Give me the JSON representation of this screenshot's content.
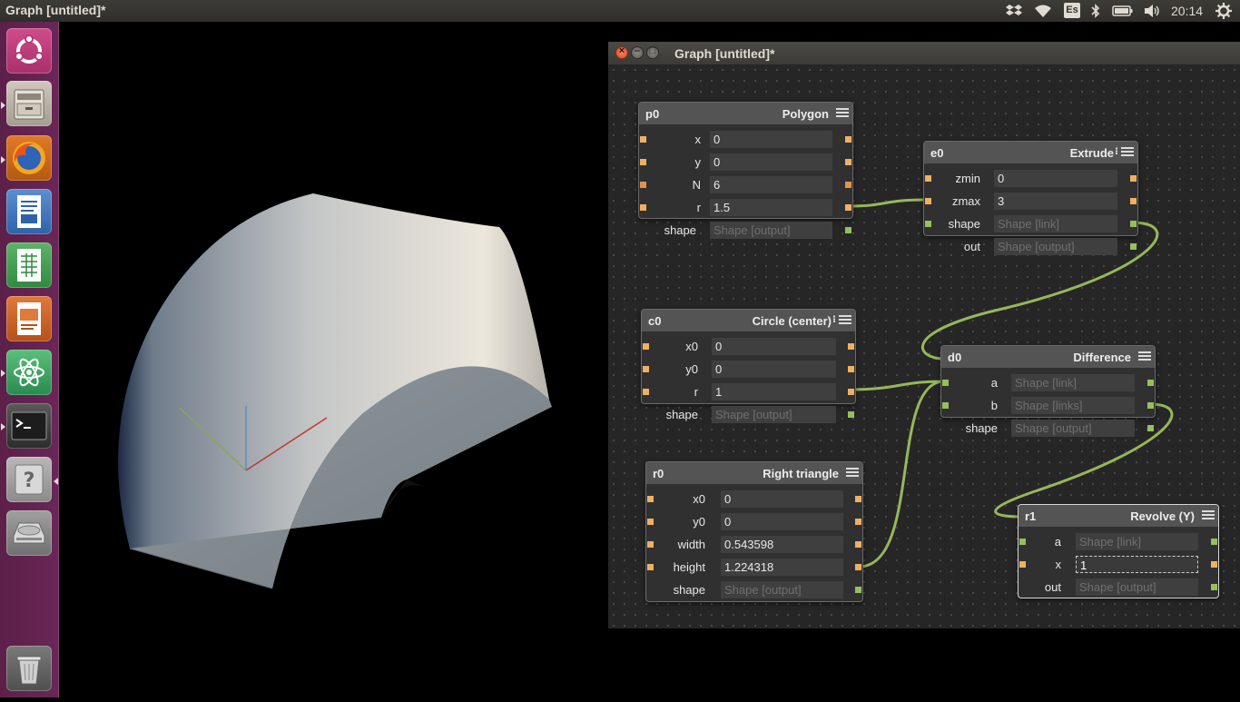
{
  "topbar": {
    "title": "Graph [untitled]*",
    "keyboard_layout": "Es",
    "clock": "20:14"
  },
  "launcher": {
    "items": [
      {
        "name": "ubuntu-dash",
        "icon": "ubuntu-logo-icon"
      },
      {
        "name": "files",
        "icon": "file-cabinet-icon"
      },
      {
        "name": "firefox",
        "icon": "firefox-icon"
      },
      {
        "name": "writer",
        "icon": "document-icon"
      },
      {
        "name": "calc",
        "icon": "spreadsheet-icon"
      },
      {
        "name": "impress",
        "icon": "presentation-icon"
      },
      {
        "name": "atom",
        "icon": "atom-icon"
      },
      {
        "name": "terminal",
        "icon": "terminal-icon"
      },
      {
        "name": "help",
        "icon": "question-icon"
      },
      {
        "name": "drive",
        "icon": "drive-icon"
      },
      {
        "name": "trash",
        "icon": "trash-icon"
      }
    ]
  },
  "graph_window": {
    "title": "Graph [untitled]*",
    "close": "×",
    "minimize": "–",
    "maximize": "□"
  },
  "nodes": {
    "p0": {
      "id": "p0",
      "type": "Polygon",
      "rows": [
        {
          "label": "x",
          "value": "0"
        },
        {
          "label": "y",
          "value": "0"
        },
        {
          "label": "N",
          "value": "6"
        },
        {
          "label": "r",
          "value": "1.5"
        },
        {
          "label": "shape",
          "value": "Shape [output]"
        }
      ]
    },
    "e0": {
      "id": "e0",
      "type": "Extrude",
      "rows": [
        {
          "label": "zmin",
          "value": "0"
        },
        {
          "label": "zmax",
          "value": "3"
        },
        {
          "label": "shape",
          "value": "Shape [link]"
        },
        {
          "label": "out",
          "value": "Shape [output]"
        }
      ]
    },
    "c0": {
      "id": "c0",
      "type": "Circle (center)",
      "rows": [
        {
          "label": "x0",
          "value": "0"
        },
        {
          "label": "y0",
          "value": "0"
        },
        {
          "label": "r",
          "value": "1"
        },
        {
          "label": "shape",
          "value": "Shape [output]"
        }
      ]
    },
    "d0": {
      "id": "d0",
      "type": "Difference",
      "rows": [
        {
          "label": "a",
          "value": "Shape [link]"
        },
        {
          "label": "b",
          "value": "Shape [links]"
        },
        {
          "label": "shape",
          "value": "Shape [output]"
        }
      ]
    },
    "r0": {
      "id": "r0",
      "type": "Right triangle",
      "rows": [
        {
          "label": "x0",
          "value": "0"
        },
        {
          "label": "y0",
          "value": "0"
        },
        {
          "label": "width",
          "value": "0.543598"
        },
        {
          "label": "height",
          "value": "1.224318"
        },
        {
          "label": "shape",
          "value": "Shape [output]"
        }
      ]
    },
    "r1": {
      "id": "r1",
      "type": "Revolve (Y)",
      "rows": [
        {
          "label": "a",
          "value": "Shape [link]"
        },
        {
          "label": "x",
          "value": "1"
        },
        {
          "label": "out",
          "value": "Shape [output]"
        }
      ]
    }
  },
  "colors": {
    "launcher_bg": "#5c2049",
    "wire": "#95b85a",
    "port": "#f0b060",
    "shape_port": "#95c05c"
  }
}
